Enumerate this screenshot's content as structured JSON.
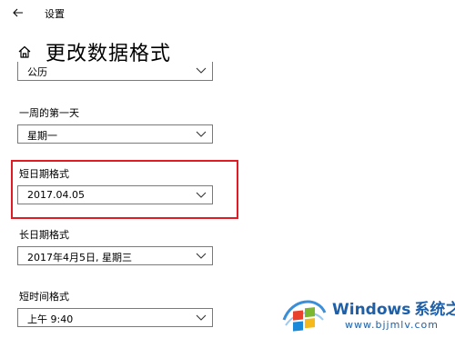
{
  "window": {
    "title": "设置"
  },
  "page": {
    "title": "更改数据格式"
  },
  "fields": {
    "calendar": {
      "value": "公历"
    },
    "first_day": {
      "label": "一周的第一天",
      "value": "星期一"
    },
    "short_date": {
      "label": "短日期格式",
      "value": "2017.04.05"
    },
    "long_date": {
      "label": "长日期格式",
      "value": "2017年4月5日, 星期三"
    },
    "short_time": {
      "label": "短时间格式",
      "value": "上午 9:40"
    }
  },
  "icons": {
    "back": "back-arrow-icon",
    "home": "home-icon",
    "dropdown": "chevron-down-icon"
  },
  "colors": {
    "highlight": "#e01b24",
    "watermark_blue": "#1d5fa8"
  },
  "watermark": {
    "brand": "Windows",
    "brand_cn": "系统之家",
    "url": "www.bjjmlv.com"
  }
}
